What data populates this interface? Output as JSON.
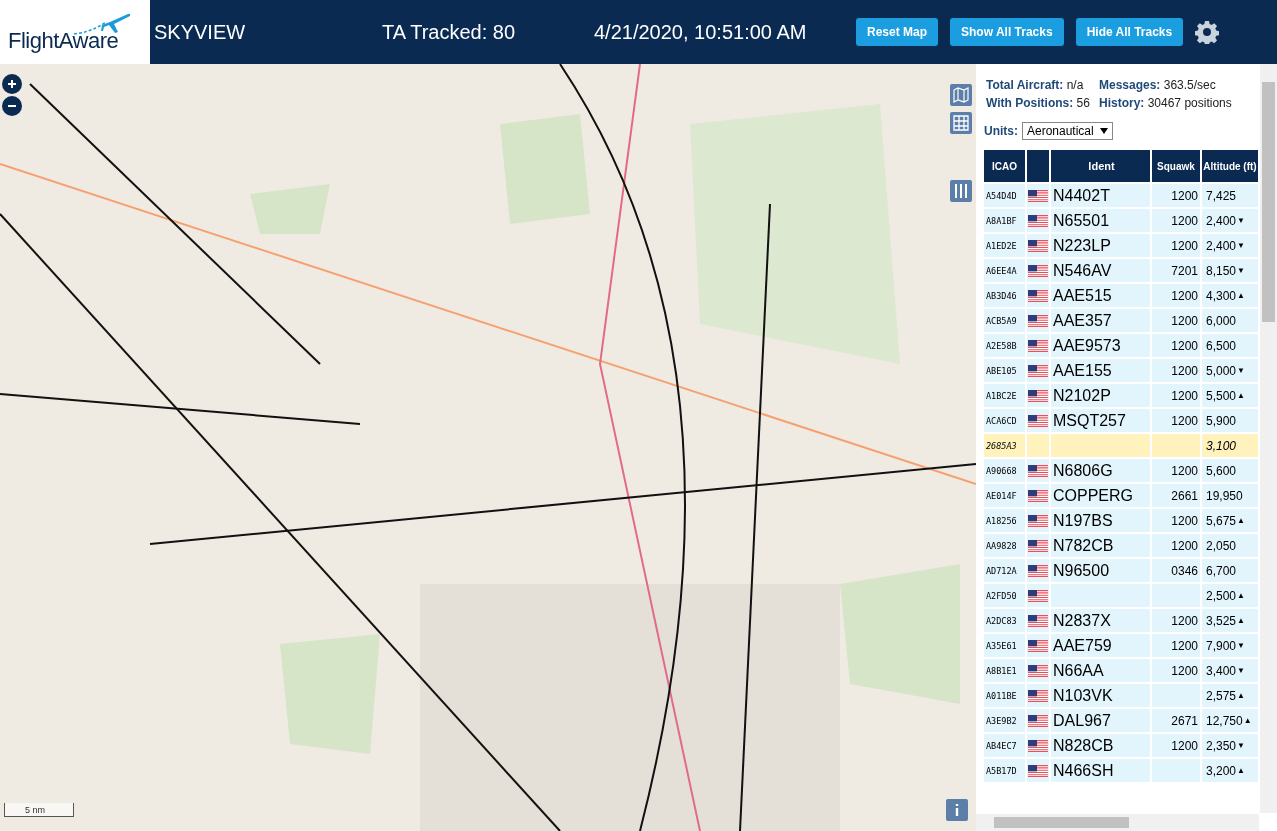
{
  "header": {
    "logo": "FlightAware",
    "app_name": "SKYVIEW",
    "tracked": "TA Tracked: 80",
    "datetime": "4/21/2020, 10:51:00 AM",
    "buttons": [
      "Reset Map",
      "Show All Tracks",
      "Hide All Tracks"
    ]
  },
  "map": {
    "scale": "5 nm"
  },
  "stats": [
    {
      "label": "Total Aircraft:",
      "value": "n/a"
    },
    {
      "label": "Messages:",
      "value": "363.5/sec"
    },
    {
      "label": "With Positions:",
      "value": "56"
    },
    {
      "label": "History:",
      "value": "30467 positions"
    }
  ],
  "units": {
    "label": "Units:",
    "value": "Aeronautical"
  },
  "table": {
    "columns": [
      "ICAO",
      "",
      "Ident",
      "Squawk",
      "Altitude (ft)"
    ],
    "rows": [
      {
        "icao": "A54D4D",
        "flag": true,
        "ident": "N4402T",
        "squawk": "1200",
        "altitude": "7,425",
        "selected": false
      },
      {
        "icao": "A8A1BF",
        "flag": true,
        "ident": "N65501",
        "squawk": "1200",
        "altitude": "2,400",
        "trend": "▼",
        "selected": false
      },
      {
        "icao": "A1ED2E",
        "flag": true,
        "ident": "N223LP",
        "squawk": "1200",
        "altitude": "2,400",
        "trend": "▼",
        "selected": false
      },
      {
        "icao": "A6EE4A",
        "flag": true,
        "ident": "N546AV",
        "squawk": "7201",
        "altitude": "8,150",
        "trend": "▼",
        "selected": false
      },
      {
        "icao": "AB3D46",
        "flag": true,
        "ident": "AAE515",
        "squawk": "1200",
        "altitude": "4,300",
        "trend": "▲",
        "selected": false
      },
      {
        "icao": "ACB5A9",
        "flag": true,
        "ident": "AAE357",
        "squawk": "1200",
        "altitude": "6,000",
        "selected": false
      },
      {
        "icao": "A2E58B",
        "flag": true,
        "ident": "AAE9573",
        "squawk": "1200",
        "altitude": "6,500",
        "selected": false
      },
      {
        "icao": "ABE105",
        "flag": true,
        "ident": "AAE155",
        "squawk": "1200",
        "altitude": "5,000",
        "trend": "▼",
        "selected": false
      },
      {
        "icao": "A1BC2E",
        "flag": true,
        "ident": "N2102P",
        "squawk": "1200",
        "altitude": "5,500",
        "trend": "▲",
        "selected": false
      },
      {
        "icao": "ACA6CD",
        "flag": true,
        "ident": "MSQT257",
        "squawk": "1200",
        "altitude": "5,900",
        "selected": false
      },
      {
        "icao": "2685A3",
        "flag": false,
        "ident": "",
        "squawk": "",
        "altitude": "3,100",
        "selected": true
      },
      {
        "icao": "A90668",
        "flag": true,
        "ident": "N6806G",
        "squawk": "1200",
        "altitude": "5,600",
        "selected": false
      },
      {
        "icao": "AE014F",
        "flag": true,
        "ident": "COPPERG",
        "squawk": "2661",
        "altitude": "19,950",
        "selected": false
      },
      {
        "icao": "A18256",
        "flag": true,
        "ident": "N197BS",
        "squawk": "1200",
        "altitude": "5,675",
        "trend": "▲",
        "selected": false
      },
      {
        "icao": "AA9828",
        "flag": true,
        "ident": "N782CB",
        "squawk": "1200",
        "altitude": "2,050",
        "selected": false
      },
      {
        "icao": "AD712A",
        "flag": true,
        "ident": "N96500",
        "squawk": "0346",
        "altitude": "6,700",
        "selected": false
      },
      {
        "icao": "A2FD50",
        "flag": true,
        "ident": "",
        "squawk": "",
        "altitude": "2,500",
        "trend": "▲",
        "selected": false
      },
      {
        "icao": "A2DC83",
        "flag": true,
        "ident": "N2837X",
        "squawk": "1200",
        "altitude": "3,525",
        "trend": "▲",
        "selected": false
      },
      {
        "icao": "A35E61",
        "flag": true,
        "ident": "AAE759",
        "squawk": "1200",
        "altitude": "7,900",
        "trend": "▼",
        "selected": false
      },
      {
        "icao": "A8B1E1",
        "flag": true,
        "ident": "N66AA",
        "squawk": "1200",
        "altitude": "3,400",
        "trend": "▼",
        "selected": false
      },
      {
        "icao": "A011BE",
        "flag": true,
        "ident": "N103VK",
        "squawk": "",
        "altitude": "2,575",
        "trend": "▲",
        "selected": false
      },
      {
        "icao": "A3E9B2",
        "flag": true,
        "ident": "DAL967",
        "squawk": "2671",
        "altitude": "12,750",
        "trend": "▲",
        "selected": false
      },
      {
        "icao": "AB4EC7",
        "flag": true,
        "ident": "N828CB",
        "squawk": "1200",
        "altitude": "2,350",
        "trend": "▼",
        "selected": false
      },
      {
        "icao": "A5B17D",
        "flag": true,
        "ident": "N466SH",
        "squawk": "",
        "altitude": "3,200",
        "trend": "▲",
        "selected": false
      }
    ]
  }
}
